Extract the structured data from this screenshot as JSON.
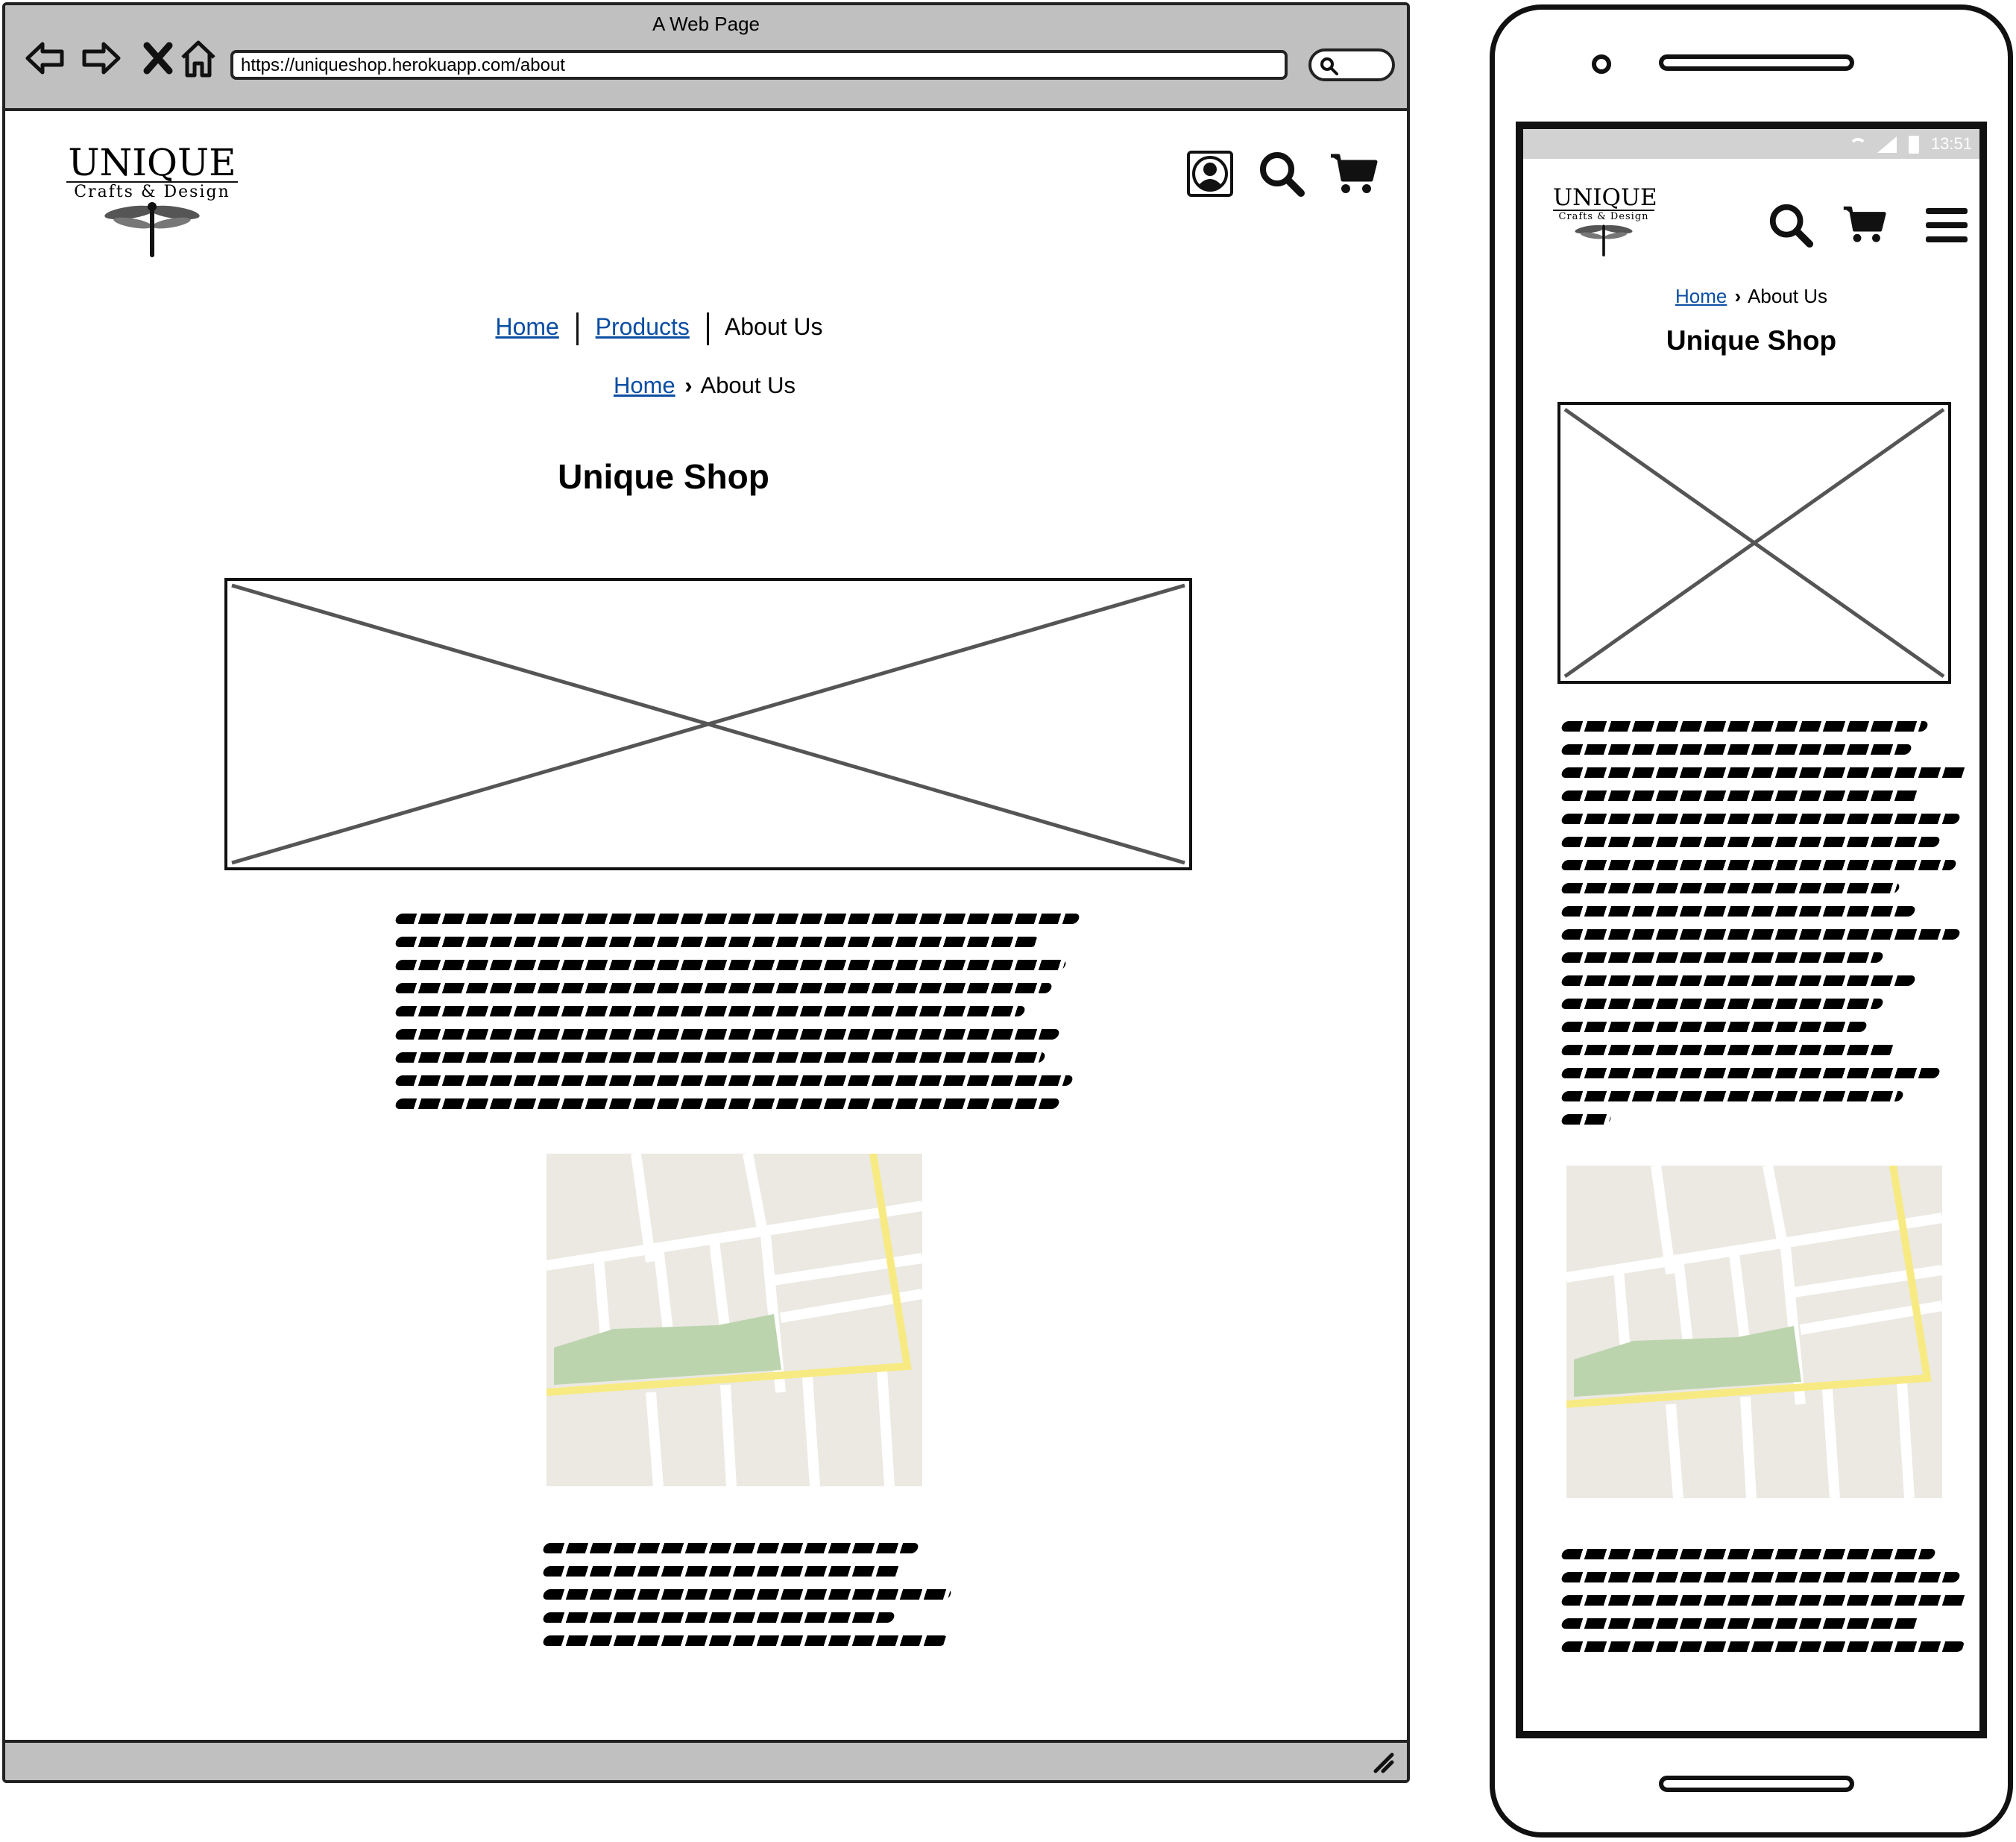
{
  "browser": {
    "title": "A Web Page",
    "url": "https://uniqueshop.herokuapp.com/about"
  },
  "logo": {
    "name": "UNIQUE",
    "tagline": "Crafts & Design"
  },
  "nav": {
    "home": "Home",
    "products": "Products",
    "about": "About Us"
  },
  "breadcrumb": {
    "home": "Home",
    "separator": "›",
    "current": "About Us"
  },
  "page_title": "Unique Shop",
  "phone": {
    "status_time": "13:51"
  },
  "colors": {
    "link": "#0b4ea2",
    "chrome": "#c0c0c0",
    "map_background": "#ebe9e2",
    "map_park": "#bcd4ae",
    "map_highway": "#f7ea82",
    "placeholder_line": "#555555"
  },
  "icons": [
    "back-arrow-icon",
    "forward-arrow-icon",
    "close-icon",
    "home-icon",
    "search-icon",
    "account-icon",
    "cart-icon",
    "menu-icon",
    "dragonfly-icon",
    "resize-grip-icon",
    "wifi-icon",
    "signal-icon",
    "battery-icon"
  ]
}
